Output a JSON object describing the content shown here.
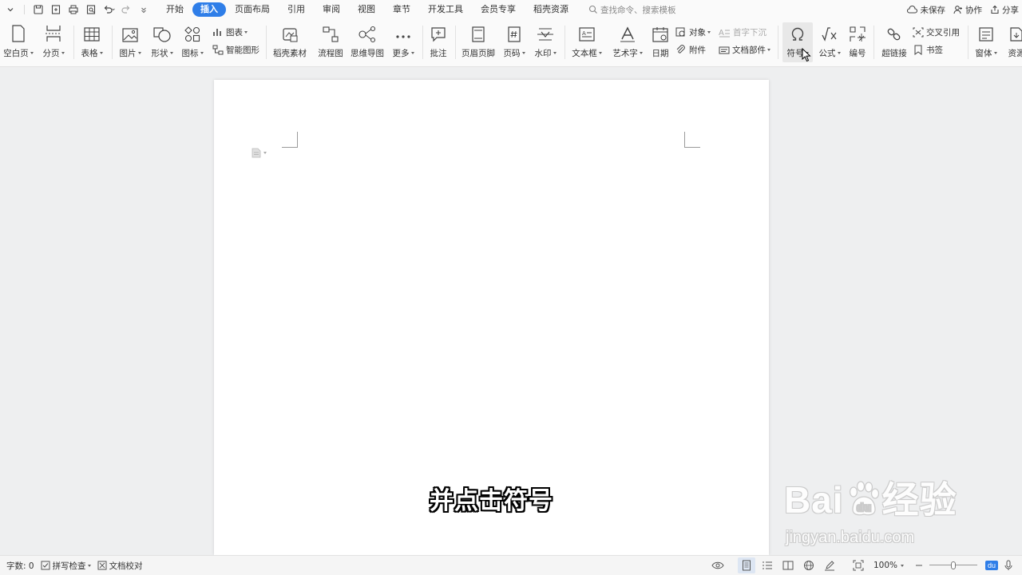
{
  "menu": {
    "tabs": [
      {
        "label": "开始",
        "active": false
      },
      {
        "label": "插入",
        "active": true
      },
      {
        "label": "页面布局",
        "active": false
      },
      {
        "label": "引用",
        "active": false
      },
      {
        "label": "审阅",
        "active": false
      },
      {
        "label": "视图",
        "active": false
      },
      {
        "label": "章节",
        "active": false
      },
      {
        "label": "开发工具",
        "active": false
      },
      {
        "label": "会员专享",
        "active": false
      },
      {
        "label": "稻壳资源",
        "active": false
      }
    ],
    "search_placeholder": "查找命令、搜索模板",
    "unsaved": "未保存",
    "collab": "协作",
    "share": "分享"
  },
  "ribbon": {
    "blank_page": "空白页",
    "page_break": "分页",
    "table": "表格",
    "picture": "图片",
    "shape": "形状",
    "icon": "图标",
    "chart": "图表",
    "smart_art": "智能图形",
    "docer_material": "稻壳素材",
    "flowchart": "流程图",
    "mindmap": "思维导图",
    "more": "更多",
    "comment": "批注",
    "header_footer": "页眉页脚",
    "page_number": "页码",
    "watermark": "水印",
    "textbox": "文本框",
    "wordart": "艺术字",
    "date": "日期",
    "object": "对象",
    "attachment": "附件",
    "drop_cap": "首字下沉",
    "doc_parts": "文档部件",
    "symbol": "符号",
    "formula": "公式",
    "numbering": "编号",
    "hyperlink": "超链接",
    "cross_ref": "交叉引用",
    "bookmark": "书签",
    "window": "窗体",
    "resource": "资源"
  },
  "document": {
    "subtitle": "并点击符号"
  },
  "watermark_logo": {
    "brand": "Bai",
    "brand2": "du",
    "brand3": "经验",
    "url": "jingyan.baidu.com"
  },
  "status": {
    "word_count": "字数: 0",
    "spell_check": "拼写检查",
    "proofread": "文档校对",
    "zoom": "100%",
    "zoom_fraction": 0.5,
    "badge": "du"
  }
}
